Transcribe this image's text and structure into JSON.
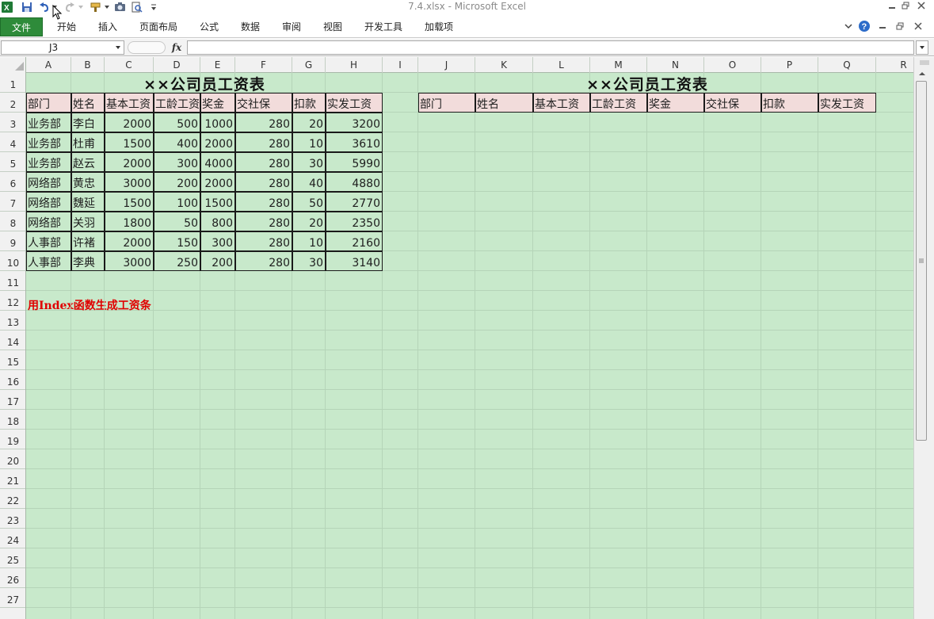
{
  "window": {
    "title": "7.4.xlsx  -  Microsoft Excel"
  },
  "quick_access": {
    "icons": [
      "excel-logo-icon",
      "save-icon",
      "undo-icon",
      "redo-icon",
      "format-painter-icon",
      "camera-icon",
      "print-preview-icon",
      "customize-icon"
    ]
  },
  "ribbon": {
    "file_tab": "文件",
    "tabs": [
      "开始",
      "插入",
      "页面布局",
      "公式",
      "数据",
      "审阅",
      "视图",
      "开发工具",
      "加载项"
    ]
  },
  "formula_bar": {
    "name_box": "J3",
    "fx_label": "fx",
    "formula": ""
  },
  "grid": {
    "columns": [
      "A",
      "B",
      "C",
      "D",
      "E",
      "F",
      "G",
      "H",
      "I",
      "J",
      "K",
      "L",
      "M",
      "N",
      "O",
      "P",
      "Q",
      "R"
    ],
    "rows": [
      "1",
      "2",
      "3",
      "4",
      "5",
      "6",
      "7",
      "8",
      "9",
      "10",
      "11",
      "12",
      "13",
      "14",
      "15",
      "16",
      "17",
      "18",
      "19",
      "20",
      "21",
      "22",
      "23",
      "24",
      "25",
      "26",
      "27"
    ]
  },
  "left_table": {
    "title": "××公司员工资表",
    "headers": [
      "部门",
      "姓名",
      "基本工资",
      "工龄工资",
      "奖金",
      "交社保",
      "扣款",
      "实发工资"
    ],
    "rows": [
      [
        "业务部",
        "李白",
        "2000",
        "500",
        "1000",
        "280",
        "20",
        "3200"
      ],
      [
        "业务部",
        "杜甫",
        "1500",
        "400",
        "2000",
        "280",
        "10",
        "3610"
      ],
      [
        "业务部",
        "赵云",
        "2000",
        "300",
        "4000",
        "280",
        "30",
        "5990"
      ],
      [
        "网络部",
        "黄忠",
        "3000",
        "200",
        "2000",
        "280",
        "40",
        "4880"
      ],
      [
        "网络部",
        "魏延",
        "1500",
        "100",
        "1500",
        "280",
        "50",
        "2770"
      ],
      [
        "网络部",
        "关羽",
        "1800",
        "50",
        "800",
        "280",
        "20",
        "2350"
      ],
      [
        "人事部",
        "许褚",
        "2000",
        "150",
        "300",
        "280",
        "10",
        "2160"
      ],
      [
        "人事部",
        "李典",
        "3000",
        "250",
        "200",
        "280",
        "30",
        "3140"
      ]
    ]
  },
  "right_table": {
    "title": "××公司员工资表",
    "headers": [
      "部门",
      "姓名",
      "基本工资",
      "工龄工资",
      "奖金",
      "交社保",
      "扣款",
      "实发工资"
    ]
  },
  "note": "用Index函数生成工资条",
  "colors": {
    "sheet_bg": "#c8e9cb",
    "header_fill": "#f2dcdb",
    "file_tab": "#2e8b3a",
    "note_text": "#e00000"
  }
}
